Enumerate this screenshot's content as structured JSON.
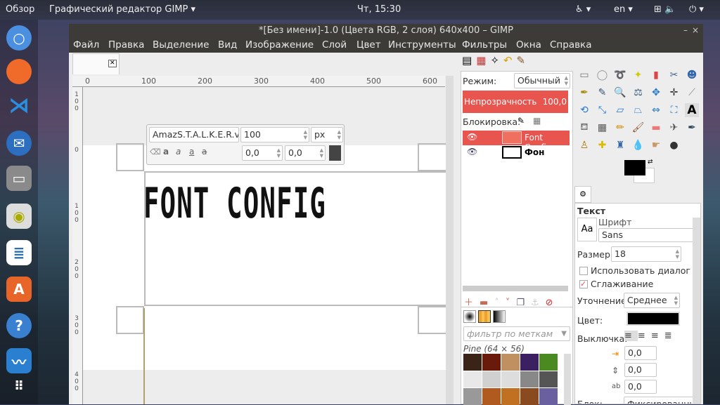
{
  "topbar": {
    "overview": "Обзор",
    "app_menu": "Графический редактор GIMP ▾",
    "clock": "Чт, 15:30",
    "lang": "en ▾",
    "accessibility": "♿ ▾",
    "status": "⏻ ▾"
  },
  "dock": {
    "items": [
      "chromium",
      "firefox",
      "vscode",
      "thunderbird",
      "files",
      "rhythmbox",
      "writer",
      "software",
      "help",
      "system-monitor",
      "show-apps"
    ]
  },
  "window": {
    "title": "*[Без имени]-1.0 (Цвета RGB, 2 слоя) 640x400 – GIMP",
    "minimize": "–",
    "close": "×"
  },
  "menu": [
    "Файл",
    "Правка",
    "Выделение",
    "Вид",
    "Изображение",
    "Слой",
    "Цвет",
    "Инструменты",
    "Фильтры",
    "Окна",
    "Справка"
  ],
  "canvas": {
    "hruler": [
      "0",
      "100",
      "200",
      "300",
      "400",
      "500",
      "600"
    ],
    "vruler": [
      "100",
      "0",
      "100",
      "200",
      "300",
      "400"
    ],
    "text": "FONT CONFIG"
  },
  "text_toolbar": {
    "font": "AmazS.T.A.L.K.E.R.v",
    "size": "100",
    "unit": "px",
    "baseline": "0,0",
    "kerning": "0,0"
  },
  "layers": {
    "mode_label": "Режим:",
    "mode": "Обычный",
    "opacity_label": "Непрозрачность",
    "opacity": "100,0",
    "lock_label": "Блокировка:",
    "items": [
      {
        "name": "Font Config",
        "selected": true
      },
      {
        "name": "Фон",
        "selected": false
      }
    ]
  },
  "patterns": {
    "filter_placeholder": "фильтр по меткам",
    "current": "Pine (64 × 56)"
  },
  "tool_options": {
    "title": "Текст",
    "font_label": "Шрифт",
    "font_preview": "Aa",
    "font": "Sans",
    "size_label": "Размер:",
    "size": "18",
    "use_editor": "Использовать диалог ред",
    "use_editor_checked": false,
    "antialias": "Сглаживание",
    "antialias_checked": true,
    "hinting_label": "Уточнение:",
    "hinting": "Среднее",
    "color_label": "Цвет:",
    "color": "#000000",
    "justify_label": "Выключка:",
    "indent": "0,0",
    "line_spacing": "0,0",
    "letter_spacing": "0,0",
    "box_label": "Блок:",
    "box": "Фиксированный"
  },
  "colors": {
    "accent": "#e8554e",
    "fg": "#000000",
    "bg": "#ffffff"
  }
}
